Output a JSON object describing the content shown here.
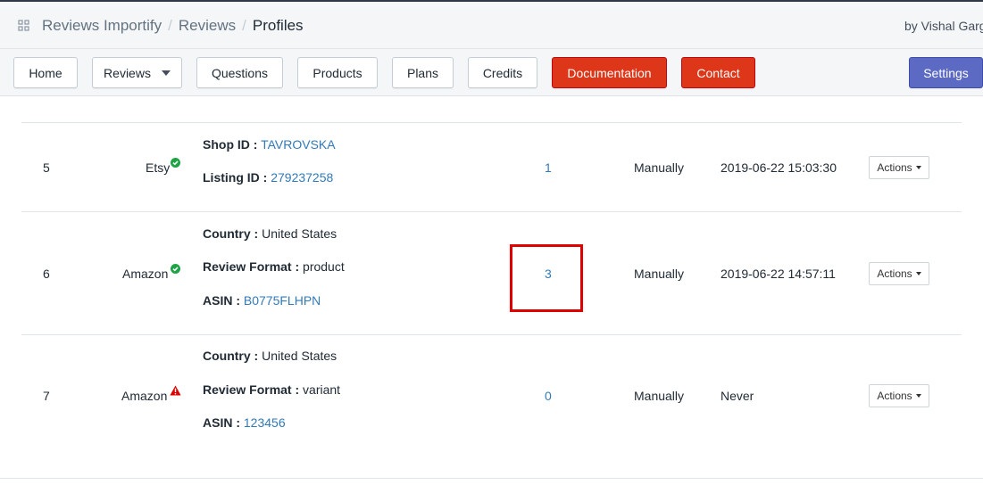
{
  "header": {
    "breadcrumb": [
      "Reviews Importify",
      "Reviews",
      "Profiles"
    ],
    "byline": "by Vishal Garg"
  },
  "nav": {
    "home": "Home",
    "reviews": "Reviews",
    "questions": "Questions",
    "products": "Products",
    "plans": "Plans",
    "credits": "Credits",
    "documentation": "Documentation",
    "contact": "Contact",
    "settings": "Settings"
  },
  "colors": {
    "danger_button": "#de3618",
    "primary_button": "#5c6ac4",
    "link": "#337ab7",
    "status_ok": "#1ea345",
    "status_warning": "#de0000",
    "highlight_box": "#e00000"
  },
  "rows": [
    {
      "index": "5",
      "source": "Etsy",
      "status_icon": "check-circle-icon",
      "details": [
        {
          "label": "Shop ID :",
          "value": "TAVROVSKA",
          "is_link": true
        },
        {
          "label": "Listing ID :",
          "value": "279237258",
          "is_link": true
        }
      ],
      "reviews": "1",
      "import_type": "Manually",
      "last_import": "2019-06-22 15:03:30",
      "actions": "Actions"
    },
    {
      "index": "6",
      "source": "Amazon",
      "status_icon": "check-circle-icon",
      "details": [
        {
          "label": "Country :",
          "value": "United States",
          "is_link": false
        },
        {
          "label": "Review Format :",
          "value": "product",
          "is_link": false
        },
        {
          "label": "ASIN :",
          "value": "B0775FLHPN",
          "is_link": true
        }
      ],
      "reviews": "3",
      "import_type": "Manually",
      "last_import": "2019-06-22 14:57:11",
      "actions": "Actions"
    },
    {
      "index": "7",
      "source": "Amazon",
      "status_icon": "warning-triangle-icon",
      "details": [
        {
          "label": "Country :",
          "value": "United States",
          "is_link": false
        },
        {
          "label": "Review Format :",
          "value": "variant",
          "is_link": false
        },
        {
          "label": "ASIN :",
          "value": "123456",
          "is_link": true
        }
      ],
      "reviews": "0",
      "import_type": "Manually",
      "last_import": "Never",
      "actions": "Actions"
    }
  ]
}
